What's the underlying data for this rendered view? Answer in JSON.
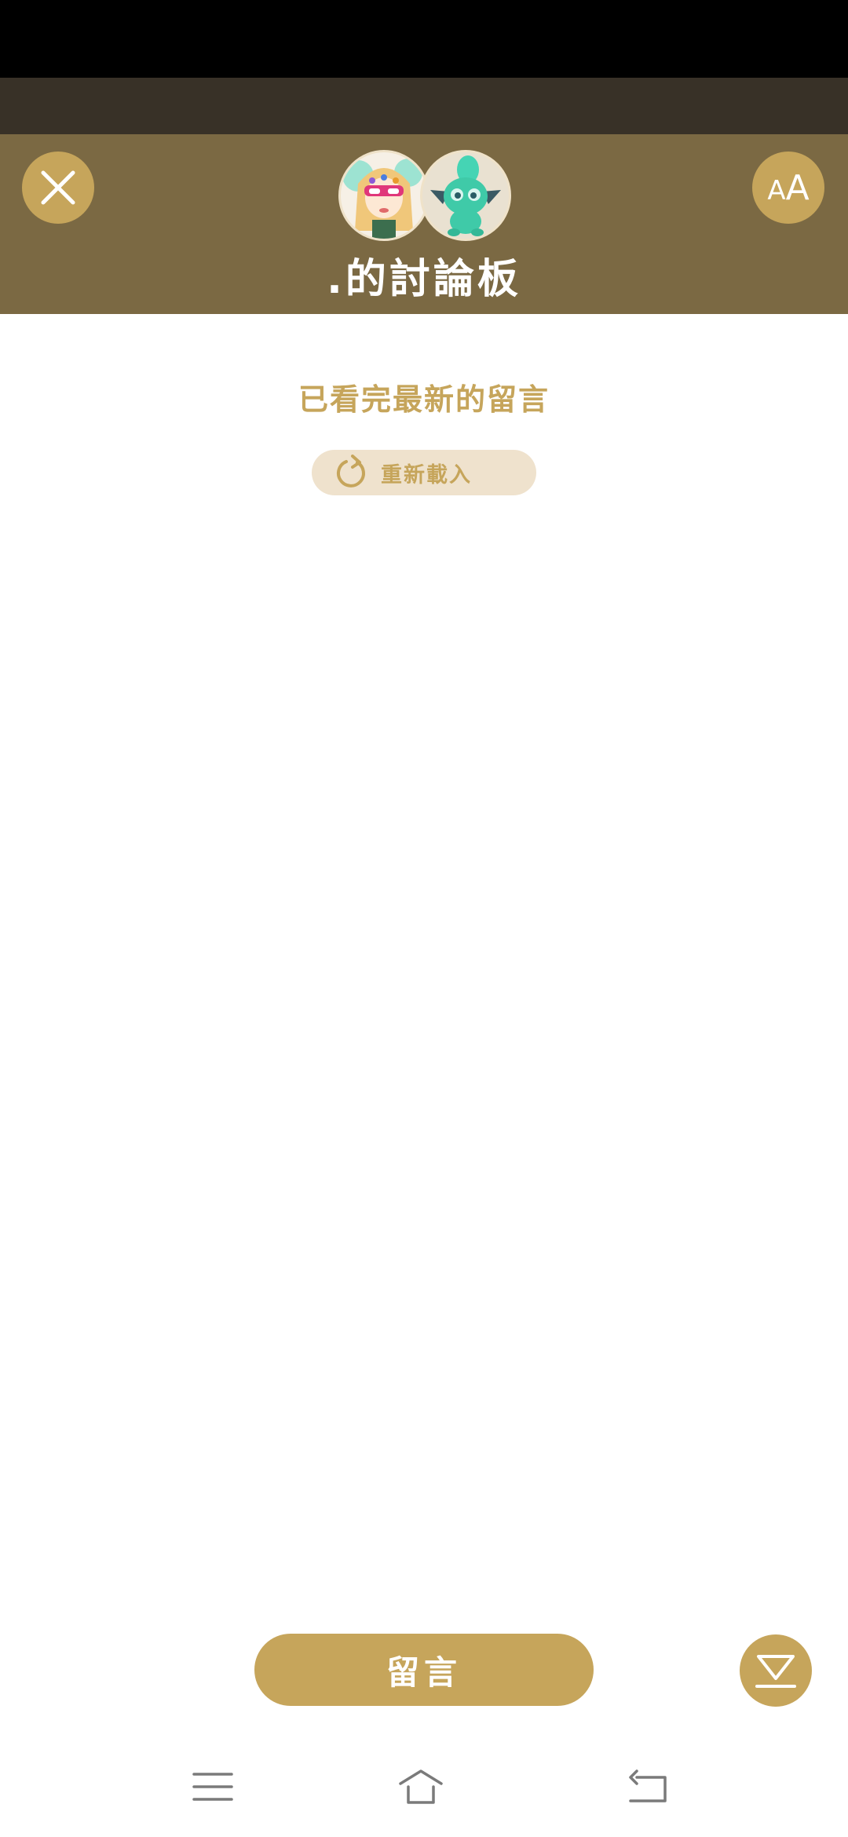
{
  "header": {
    "title": ".的討論板",
    "close_icon": "close-icon",
    "font_size_icon": "font-size-icon",
    "font_size_small": "A",
    "font_size_big": "A"
  },
  "main": {
    "status_message": "已看完最新的留言",
    "reload_label": "重新載入"
  },
  "footer": {
    "comment_label": "留言",
    "scroll_bottom_icon": "scroll-to-bottom-icon"
  },
  "system_nav": {
    "items": [
      "menu-icon",
      "home-icon",
      "back-icon"
    ]
  },
  "colors": {
    "status_bar": "#000000",
    "dark_band": "#383127",
    "header_bg": "#7b6943",
    "accent_gold": "#c6a55b",
    "reload_bg": "#efe2cd",
    "nav_gray": "#7a7a7a"
  }
}
